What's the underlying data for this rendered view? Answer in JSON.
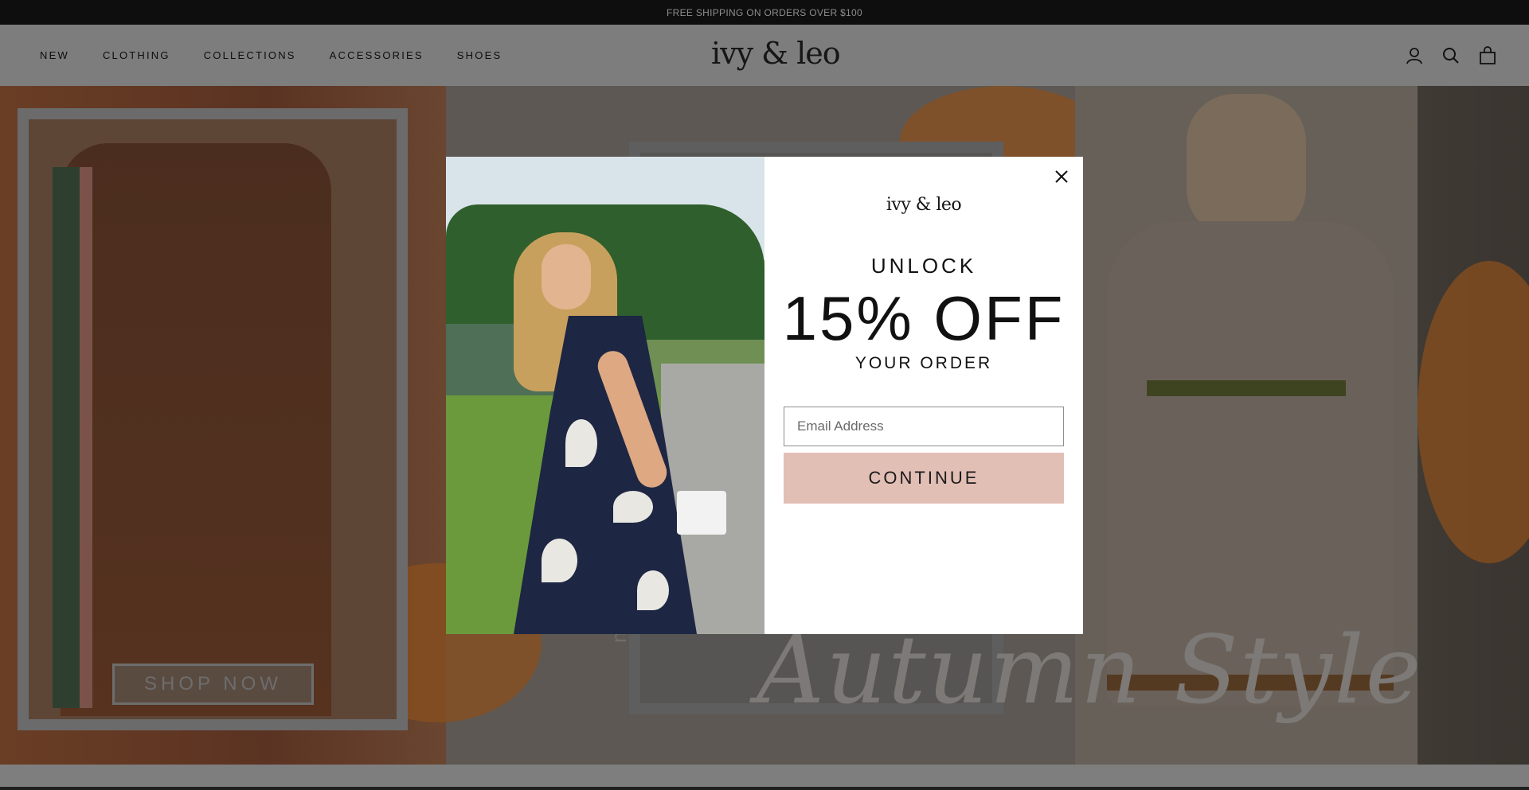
{
  "announcement": {
    "text": "FREE SHIPPING ON ORDERS OVER $100"
  },
  "header": {
    "nav": [
      "NEW",
      "CLOTHING",
      "COLLECTIONS",
      "ACCESSORIES",
      "SHOES"
    ],
    "logo": "ivy & leo",
    "icons": [
      "account-icon",
      "search-icon",
      "cart-icon"
    ]
  },
  "hero": {
    "shop_now": "SHOP NOW",
    "vertical_text": "new",
    "script_text": "Autumn Style"
  },
  "popup": {
    "logo": "ivy & leo",
    "unlock": "UNLOCK",
    "discount": "15% OFF",
    "subline": "YOUR ORDER",
    "email_placeholder": "Email Address",
    "continue_label": "CONTINUE",
    "close_icon": "close-icon",
    "accent_color": "#e2bfb5"
  }
}
